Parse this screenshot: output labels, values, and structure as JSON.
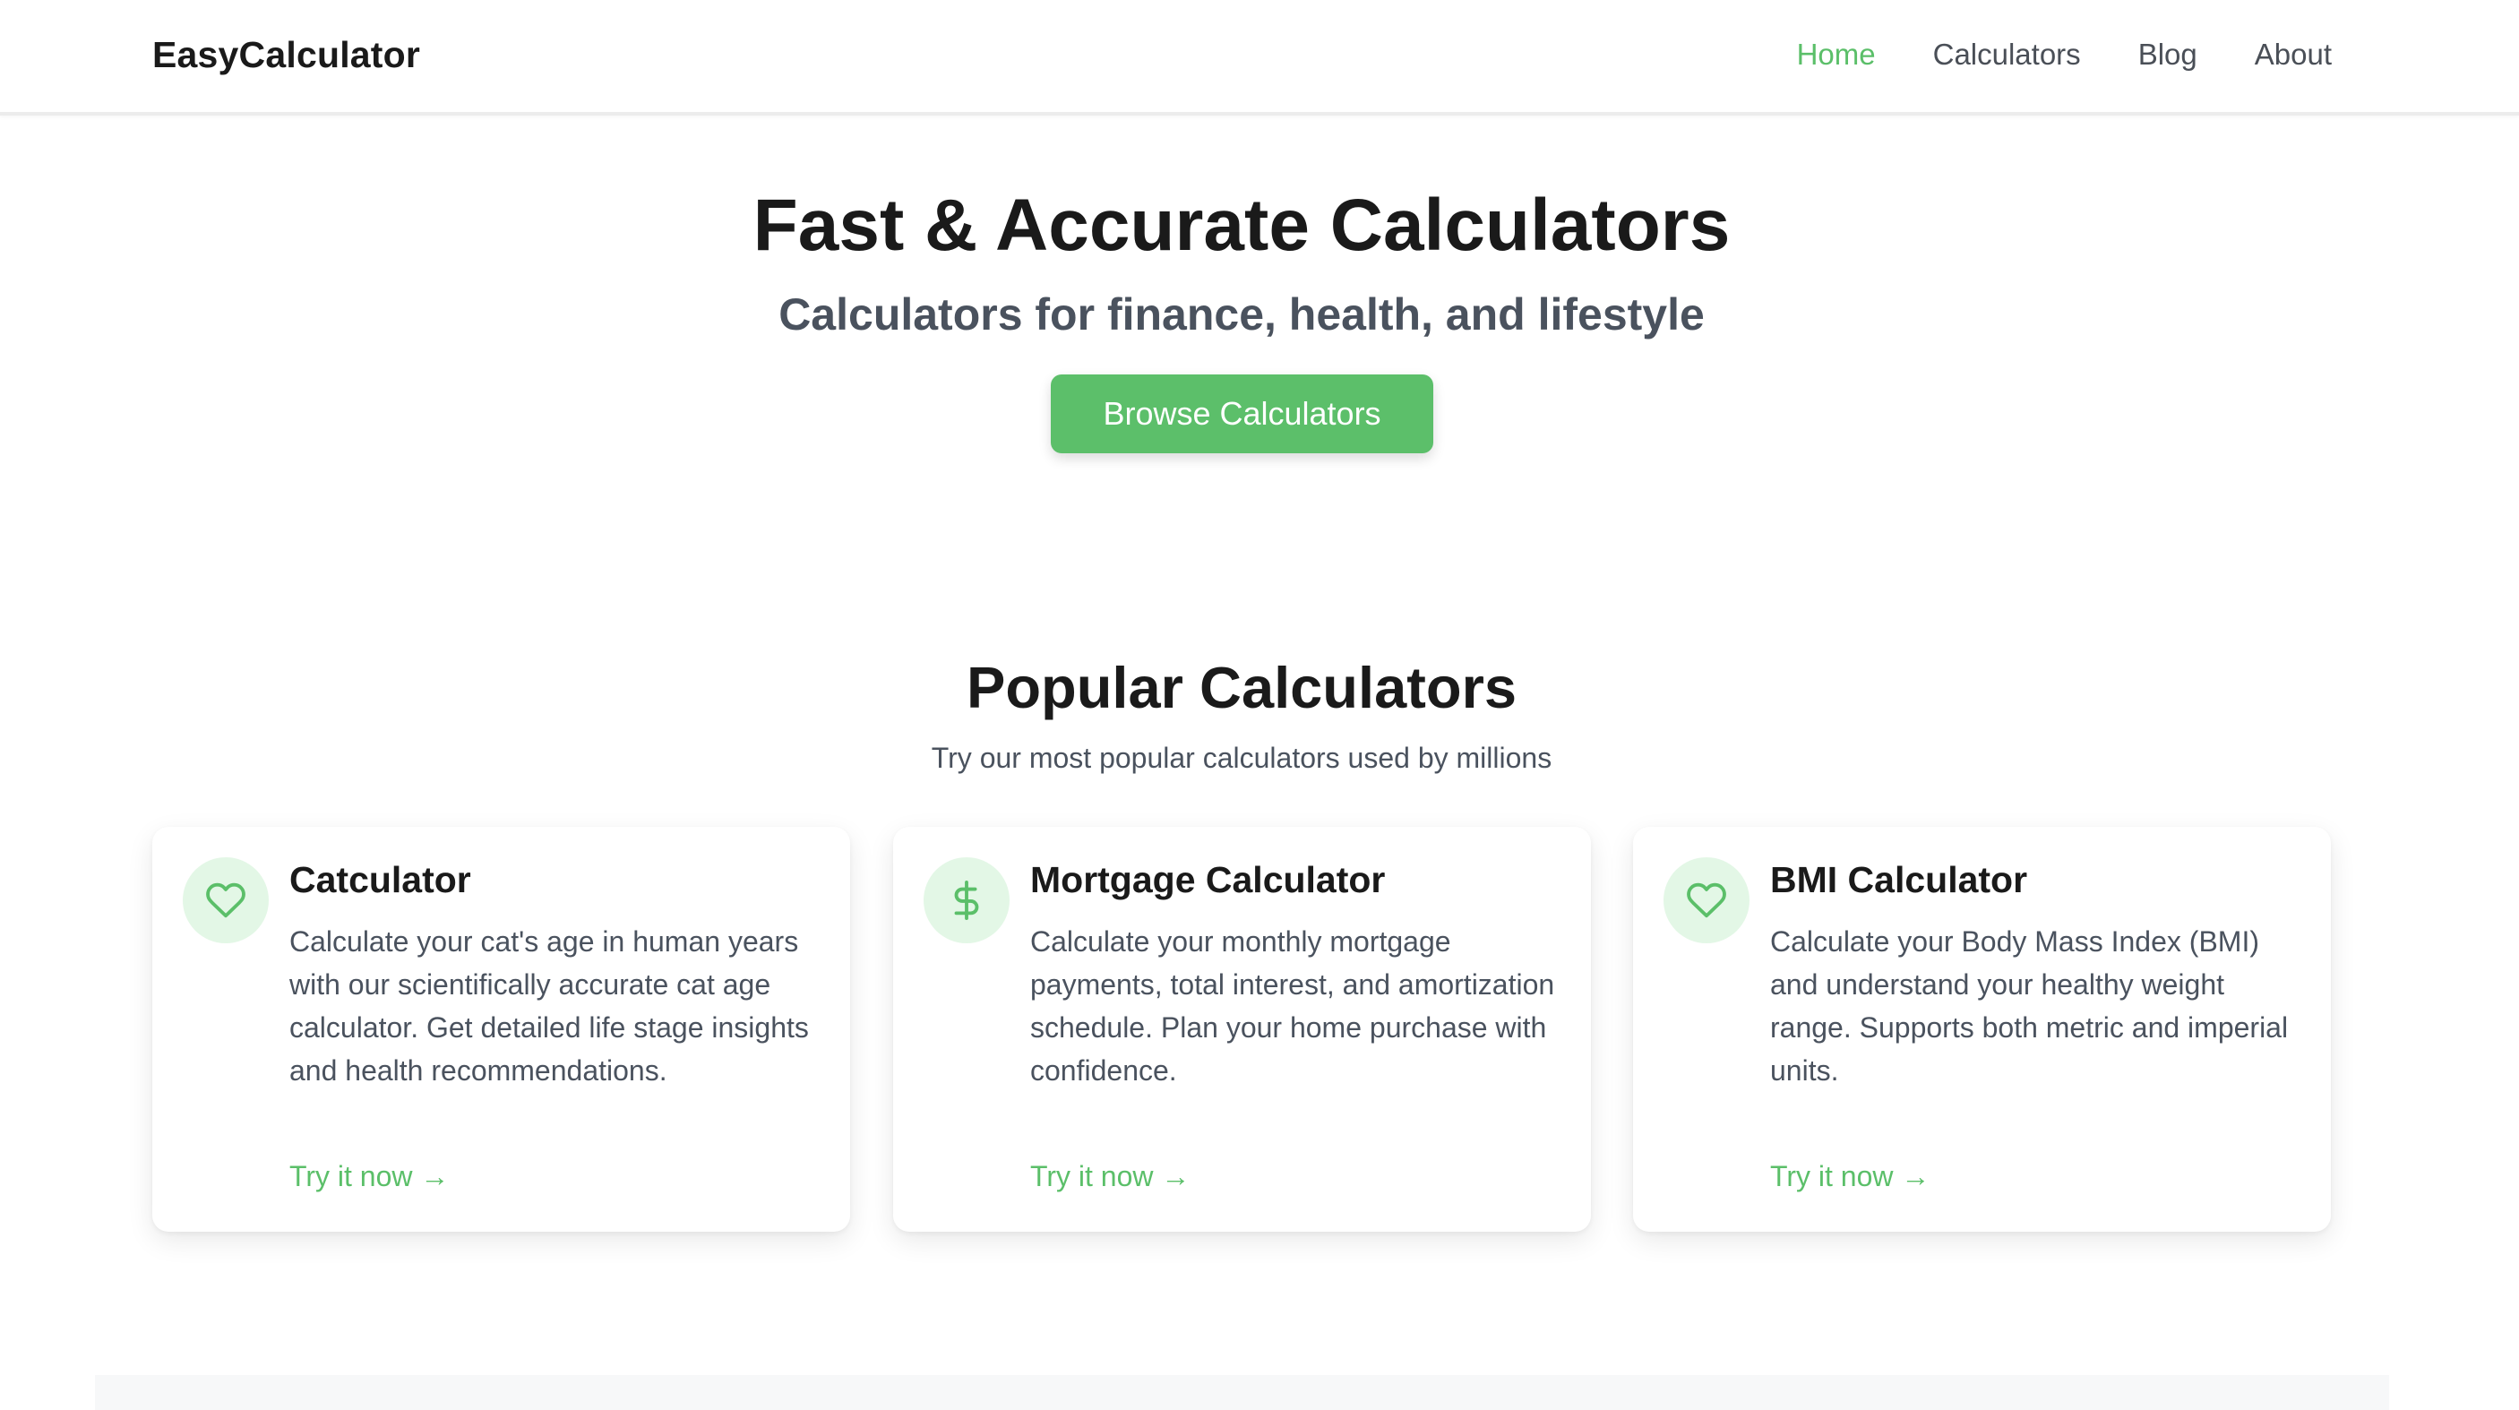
{
  "header": {
    "brand": "EasyCalculator",
    "nav": [
      {
        "label": "Home",
        "active": true
      },
      {
        "label": "Calculators",
        "active": false
      },
      {
        "label": "Blog",
        "active": false
      },
      {
        "label": "About",
        "active": false
      }
    ]
  },
  "hero": {
    "title": "Fast & Accurate Calculators",
    "subtitle": "Calculators for finance, health, and lifestyle",
    "cta_label": "Browse Calculators"
  },
  "popular": {
    "title": "Popular Calculators",
    "subtitle": "Try our most popular calculators used by millions",
    "cards": [
      {
        "icon": "heart-icon",
        "title": "Catculator",
        "description": "Calculate your cat's age in human years with our scientifically accurate cat age calculator. Get detailed life stage insights and health recommendations.",
        "link_label": "Try it now →"
      },
      {
        "icon": "dollar-icon",
        "title": "Mortgage Calculator",
        "description": "Calculate your monthly mortgage payments, total interest, and amortization schedule. Plan your home purchase with confidence.",
        "link_label": "Try it now →"
      },
      {
        "icon": "heart-icon",
        "title": "BMI Calculator",
        "description": "Calculate your Body Mass Index (BMI) and understand your healthy weight range. Supports both metric and imperial units.",
        "link_label": "Try it now →"
      }
    ]
  },
  "colors": {
    "accent": "#5cbf6a",
    "icon_bg": "#e3f7e6",
    "text": "#1a1a1a",
    "muted": "#4a525e"
  }
}
